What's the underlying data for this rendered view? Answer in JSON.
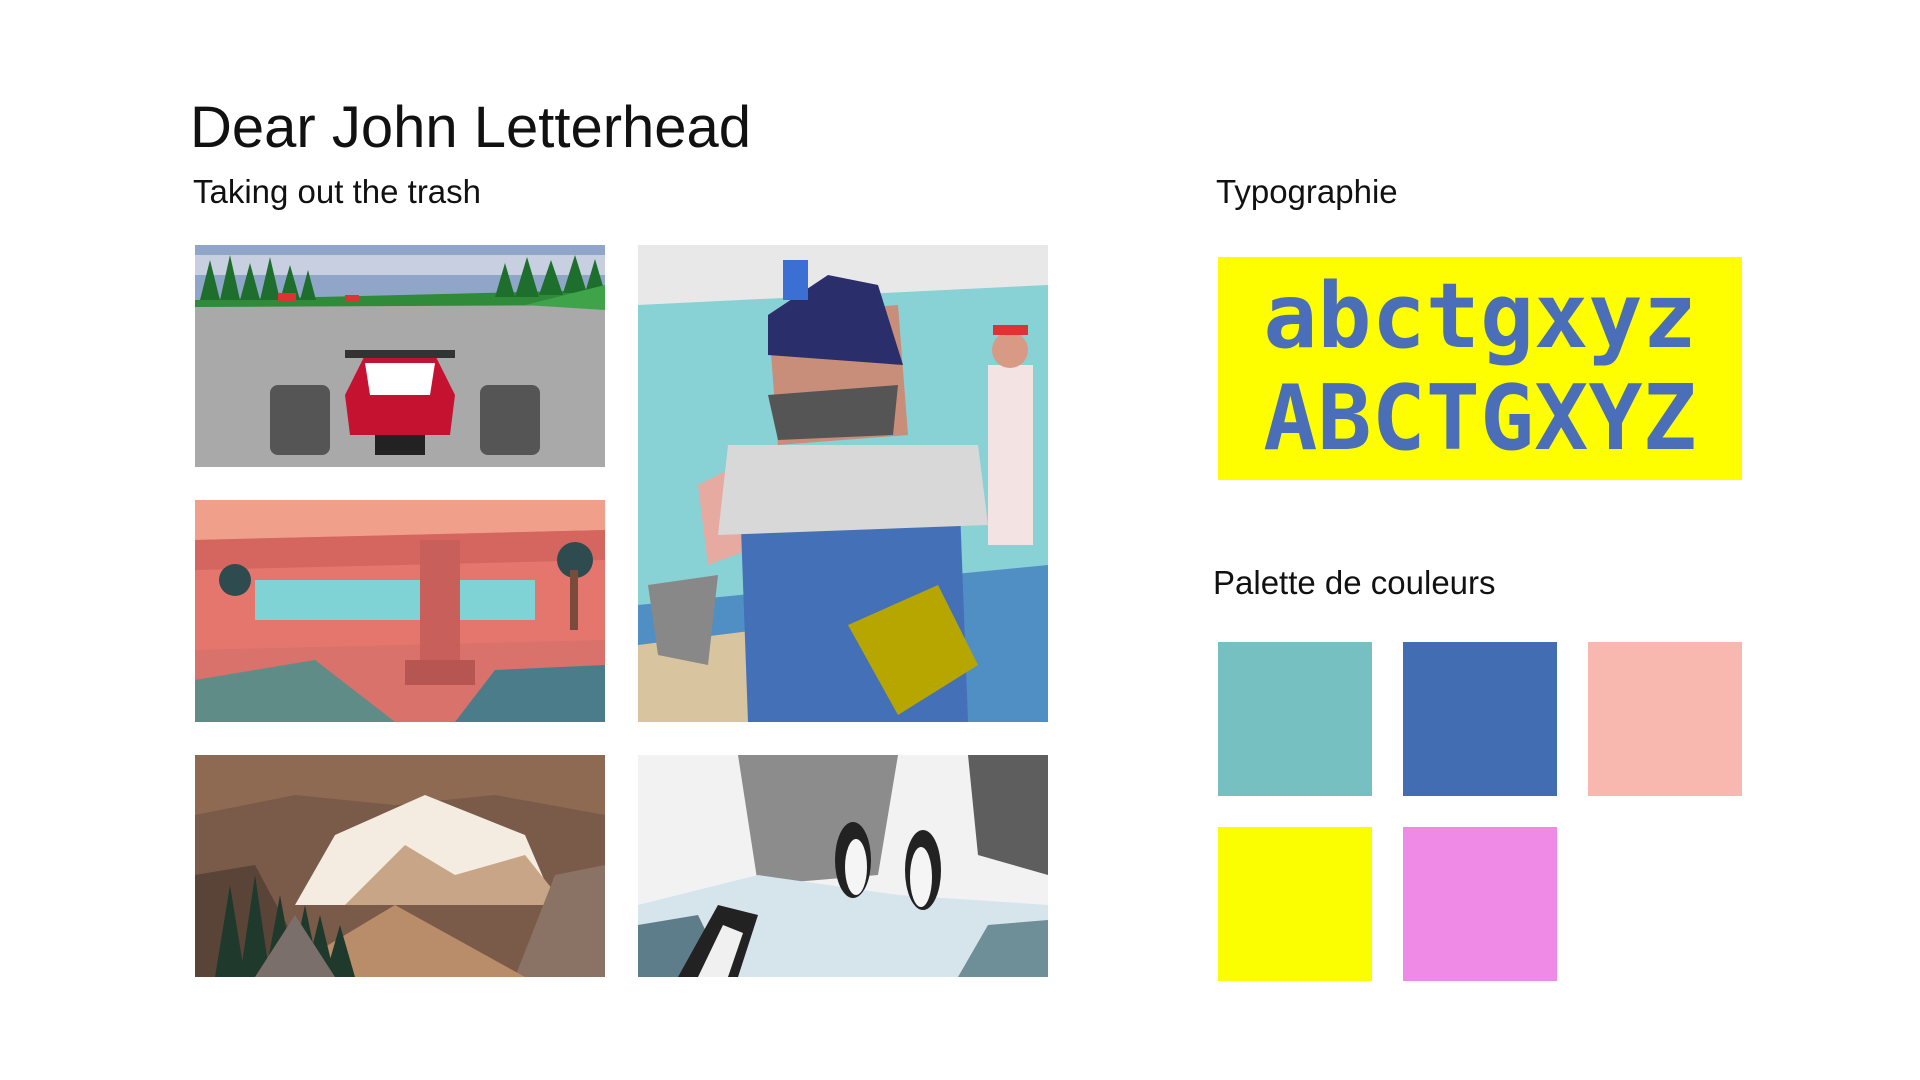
{
  "title": "Dear John Letterhead",
  "gallery": {
    "heading": "Taking out the trash",
    "images": [
      {
        "name": "racing-car-screenshot"
      },
      {
        "name": "pink-canyon-screenshot"
      },
      {
        "name": "lowpoly-cave-screenshot"
      },
      {
        "name": "plumber-character-screenshot"
      },
      {
        "name": "penguins-screenshot"
      }
    ]
  },
  "typography": {
    "heading": "Typographie",
    "lowercase": "abctgxyz",
    "uppercase": "ABCTGXYZ",
    "background": "#fffe00",
    "text_color": "#4a6fb8"
  },
  "palette": {
    "heading": "Palette de couleurs",
    "colors": [
      "#76c0c1",
      "#426db3",
      "#f8b8af",
      "#fafe00",
      "#ef8be6"
    ]
  }
}
